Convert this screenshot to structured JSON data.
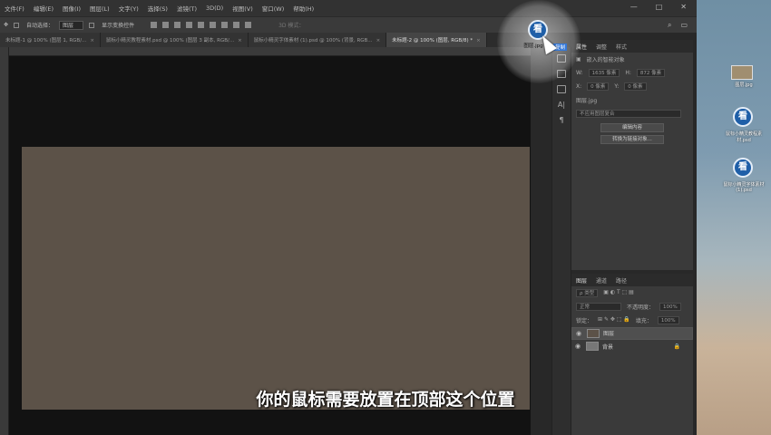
{
  "menu": [
    "文件(F)",
    "编辑(E)",
    "图像(I)",
    "图层(L)",
    "文字(Y)",
    "选择(S)",
    "滤镜(T)",
    "3D(D)",
    "视图(V)",
    "窗口(W)",
    "帮助(H)"
  ],
  "window_controls": [
    "—",
    "□",
    "✕"
  ],
  "options": {
    "auto_select_label": "自动选择：",
    "auto_select_value": "图层",
    "show_transform_label": "显示变换控件",
    "mode_3d": "3D 模式："
  },
  "tabs": [
    {
      "label": "未标题-1 @ 100% (图层 1, RGB/...",
      "active": false
    },
    {
      "label": "鼠标小精灵教程素材.psd @ 100% (图层 3 副本, RGB/...",
      "active": false
    },
    {
      "label": "鼠标小精灵字体素材 (1).psd @ 100% (背景, RGB...",
      "active": false
    },
    {
      "label": "未标题-2 @ 100% (图层, RGB/8) *",
      "active": true
    }
  ],
  "tool_icons": [
    "history-icon",
    "adjust-icon",
    "character-icon",
    "paragraph-icon"
  ],
  "properties": {
    "tabs": [
      "属性",
      "调整",
      "样式"
    ],
    "title": "嵌入的智能对象",
    "w_label": "W:",
    "w_value": "1635 像素",
    "h_label": "H:",
    "h_value": "872 像素",
    "x_label": "X:",
    "x_value": "0 像素",
    "y_label": "Y:",
    "y_value": "0 像素",
    "file_label": "图层.jpg",
    "comp_placeholder": "不应用图层复合",
    "edit_button": "编辑内容",
    "convert_button": "转换为链接对象..."
  },
  "layers_panel": {
    "tabs": [
      "图层",
      "通道",
      "路径"
    ],
    "filter_label": "ρ 类型",
    "blend_mode": "正常",
    "opacity_label": "不透明度：",
    "opacity_value": "100%",
    "lock_label": "锁定：",
    "fill_label": "填充：",
    "fill_value": "100%",
    "layers": [
      {
        "name": "图层",
        "selected": true
      },
      {
        "name": "背景",
        "selected": false
      }
    ]
  },
  "desktop": {
    "file_label": "图层.jpg",
    "icon1_label": "鼠标小精灵教程素材.psd",
    "icon2_label": "鼠标小精灵字体素材 (1).psd"
  },
  "drag_icon": {
    "glyph": "看",
    "label": "图层.jpg",
    "tooltip": "复制"
  },
  "subtitle": "你的鼠标需要放置在顶部这个位置"
}
